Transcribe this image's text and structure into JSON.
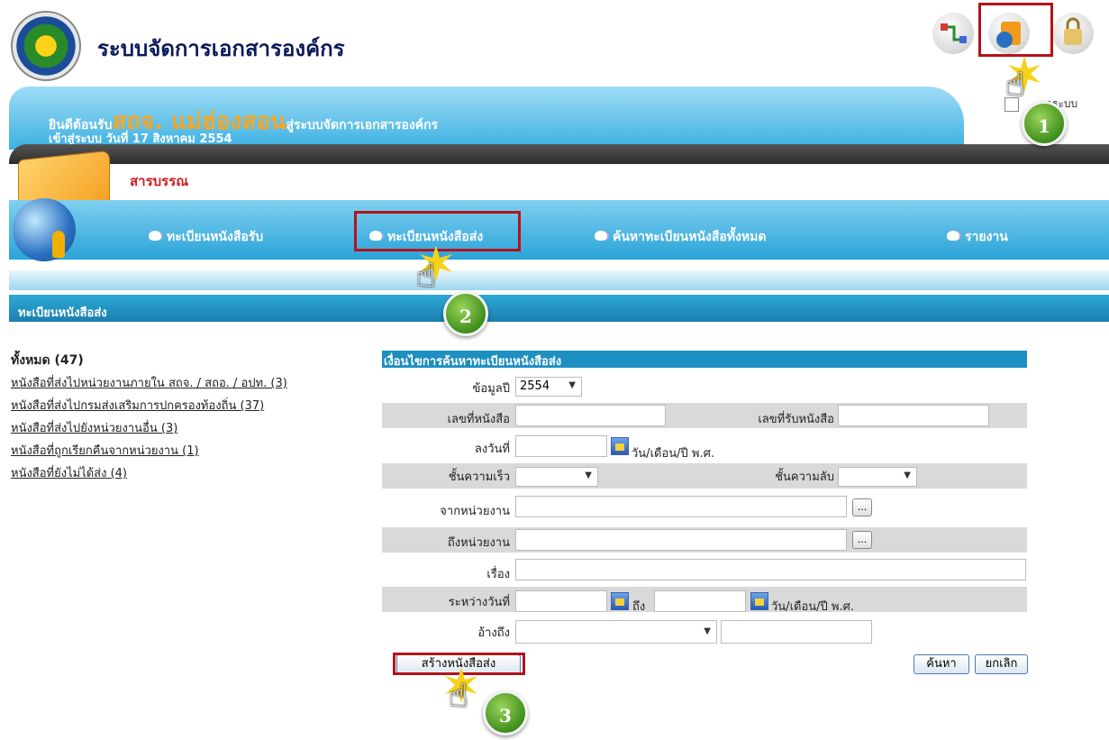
{
  "header": {
    "app_title": "ระบบจัดการเอกสารองค์กร",
    "icons": [
      "flow-icon",
      "document-folder-icon",
      "key-lock-icon"
    ]
  },
  "banner": {
    "welcome_prefix": "ยินดีต้อนรับ",
    "org_name": "สถจ. แม่ฮ่องสอน",
    "welcome_suffix": "สู่ระบบจัดการเอกสารองค์กร",
    "login_line": "เข้าสู่ระบบ วันที่ 17 สิงหาคม 2554",
    "logout_fragment": "ากระบบ"
  },
  "module": {
    "title": "สารบรรณ"
  },
  "nav": {
    "receive": "ทะเบียนหนังสือรับ",
    "send": "ทะเบียนหนังสือส่ง",
    "search": "ค้นหาทะเบียนหนังสือทั้งหมด",
    "report": "รายงาน"
  },
  "section": {
    "title": "ทะเบียนหนังสือส่ง"
  },
  "sidebar": {
    "all_label": "ทั้งหมด (47)",
    "items": [
      "หนังสือที่ส่งไปหน่วยงานภายใน สถจ. / สถอ. / อปท. (3)",
      "หนังสือที่ส่งไปกรมส่งเสริมการปกครองท้องถิ่น (37)",
      "หนังสือที่ส่งไปยังหน่วยงานอื่น (3)",
      "หนังสือที่ถูกเรียกคืนจากหน่วยงาน (1)",
      "หนังสือที่ยังไม่ได้ส่ง (4)"
    ]
  },
  "form": {
    "title": "เงื่อนไขการค้นหาทะเบียนหนังสือส่ง",
    "year_label": "ข้อมูลปี",
    "year_value": "2554",
    "doc_no_label": "เลขที่หนังสือ",
    "recv_no_label": "เลขที่รับหนังสือ",
    "date_label": "ลงวันที่",
    "date_hint": "วัน/เดือน/ปี พ.ศ.",
    "urgency_label": "ชั้นความเร็ว",
    "secrecy_label": "ชั้นความลับ",
    "from_label": "จากหน่วยงาน",
    "to_label": "ถึงหน่วยงาน",
    "subject_label": "เรื่อง",
    "between_label": "ระหว่างวันที่",
    "to_word": "ถึง",
    "between_hint": "วัน/เดือน/ปี พ.ศ.",
    "ref_label": "อ้างถึง",
    "ellipsis": "...",
    "create_button": "สร้างหนังสือส่ง",
    "search_button": "ค้นหา",
    "cancel_button": "ยกเลิก"
  },
  "callouts": [
    "1",
    "2",
    "3"
  ]
}
